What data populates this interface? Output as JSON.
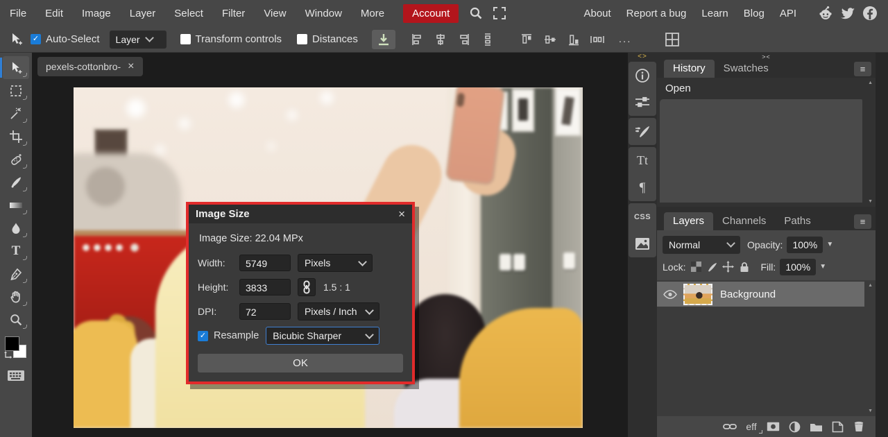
{
  "menu_bar": {
    "items": [
      "File",
      "Edit",
      "Image",
      "Layer",
      "Select",
      "Filter",
      "View",
      "Window",
      "More"
    ],
    "account": "Account",
    "account_color": "#b3151c",
    "links": [
      "About",
      "Report a bug",
      "Learn",
      "Blog",
      "API"
    ],
    "icons": [
      "search-icon",
      "fullscreen-icon",
      "reddit-icon",
      "twitter-icon",
      "facebook-icon"
    ]
  },
  "options_bar": {
    "auto_select": {
      "label": "Auto-Select",
      "checked": true
    },
    "target": {
      "value": "Layer"
    },
    "transform": {
      "label": "Transform controls",
      "checked": false
    },
    "distances": {
      "label": "Distances",
      "checked": false
    },
    "more_glyph": "...",
    "icons": [
      "move-cursor-icon",
      "export-icon",
      "align-left-icon",
      "align-center-h-icon",
      "align-right-icon",
      "distribute-v-icon",
      "align-top-icon",
      "align-middle-icon",
      "align-bottom-icon",
      "distribute-h-icon",
      "workspace-grid-icon"
    ]
  },
  "document_tab": {
    "title": "pexels-cottonbro-"
  },
  "tools": {
    "list": [
      "move",
      "marquee",
      "magic-wand",
      "crop",
      "healing-brush",
      "brush",
      "gradient",
      "blur",
      "type",
      "pen",
      "hand",
      "zoom"
    ],
    "selected": "move",
    "type_glyph": "T",
    "accent": "#2f7fd6"
  },
  "dialog": {
    "title": "Image Size",
    "info": "Image Size: 22.04 MPx",
    "width": {
      "label": "Width:",
      "value": "5749",
      "unit": "Pixels"
    },
    "height": {
      "label": "Height:",
      "value": "3833",
      "ratio": "1.5 : 1"
    },
    "dpi": {
      "label": "DPI:",
      "value": "72",
      "unit": "Pixels / Inch"
    },
    "resample": {
      "label": "Resample",
      "checked": true,
      "method": "Bicubic Sharper"
    },
    "ok": "OK",
    "annotation_color": "#e12b2b",
    "focus_color": "#3f7fd0"
  },
  "right_rail": {
    "collapse": "<>",
    "tt": "Tt",
    "pilcrow": "¶",
    "css": "CSS",
    "icons": [
      "info-icon",
      "properties-icon",
      "brush-settings-icon",
      "character-icon",
      "paragraph-icon",
      "css-icon",
      "image-icon"
    ]
  },
  "history_panel": {
    "collapse": "><",
    "tabs": [
      "History",
      "Swatches"
    ],
    "active_tab": "History",
    "entries": [
      "Open"
    ]
  },
  "layers_panel": {
    "tabs": [
      "Layers",
      "Channels",
      "Paths"
    ],
    "active_tab": "Layers",
    "blend_mode": "Normal",
    "opacity_label": "Opacity:",
    "opacity": "100%",
    "lock_label": "Lock:",
    "lock_icons": [
      "lock-transparency-icon",
      "lock-paint-icon",
      "lock-position-icon",
      "lock-all-icon"
    ],
    "fill_label": "Fill:",
    "fill": "100%",
    "layers": [
      {
        "name": "Background",
        "visible": true,
        "selected": true
      }
    ],
    "eff": "eff",
    "bottom_icons": [
      "link-icon",
      "effects-icon",
      "mask-icon",
      "adjustment-icon",
      "folder-icon",
      "new-layer-icon",
      "delete-icon"
    ]
  },
  "glyphs": {
    "close": "×",
    "check": "✓",
    "menu": "≡",
    "dropdown": "▼",
    "up": "▲",
    "down": "▼"
  },
  "colors": {
    "checkbox_blue": "#1a7cd8",
    "chrome": "#474747",
    "panel_dark": "#2e2e2e"
  }
}
